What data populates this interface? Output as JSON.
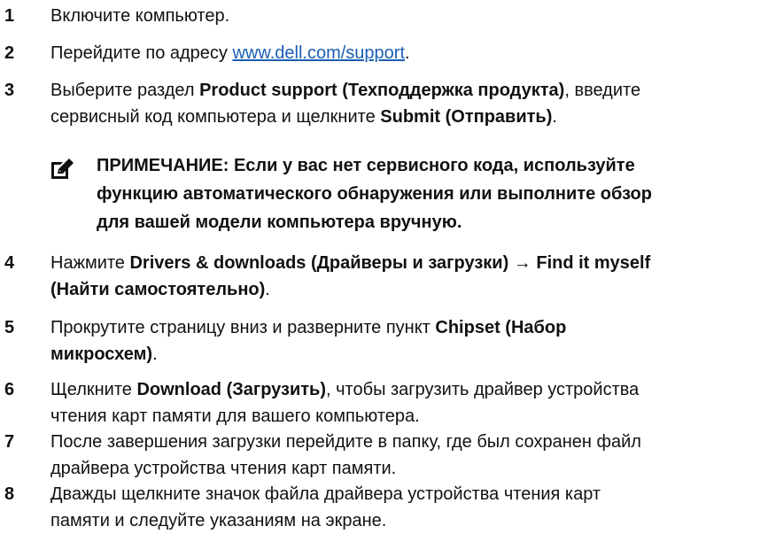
{
  "steps": [
    {
      "num": "1",
      "text": "Включите компьютер."
    },
    {
      "num": "2",
      "pre": "Перейдите по адресу ",
      "link": "www.dell.com/support",
      "post": "."
    },
    {
      "num": "3",
      "pre": "Выберите раздел ",
      "bold1": "Product support (Техподдержка продукта)",
      "mid": ", введите",
      "line2": "сервисный код компьютера и щелкните ",
      "bold2": "Submit (Отправить)",
      "post": "."
    },
    {
      "num": "4",
      "pre": "Нажмите ",
      "bold1": "Drivers & downloads (Драйверы и загрузки)",
      "arrow": " → ",
      "bold2": "Find it myself",
      "line2bold": "(Найти самостоятельно)",
      "post": "."
    },
    {
      "num": "5",
      "line1": "Прокрутите страницу вниз и разверните пункт ",
      "bold1": "Chipset (Набор",
      "line2bold": "микросхем)",
      "post": "."
    },
    {
      "num": "6",
      "pre": "Щелкните ",
      "bold1": "Download (Загрузить)",
      "mid": ", чтобы загрузить драйвер устройства",
      "line2": "чтения карт памяти для вашего компьютера."
    },
    {
      "num": "7",
      "line1": "После завершения загрузки перейдите в папку, где был сохранен файл",
      "line2": "драйвера устройства чтения карт памяти."
    },
    {
      "num": "8",
      "line1": "Дважды щелкните значок файла драйвера устройства чтения карт",
      "line2": "памяти и следуйте указаниям на экране."
    }
  ],
  "note": {
    "line1": "ПРИМЕЧАНИЕ: Если у вас нет сервисного кода, используйте",
    "line2": "функцию автоматического обнаружения или выполните обзор",
    "line3": "для вашей модели компьютера вручную.",
    "icon": "pencil-note-icon"
  }
}
